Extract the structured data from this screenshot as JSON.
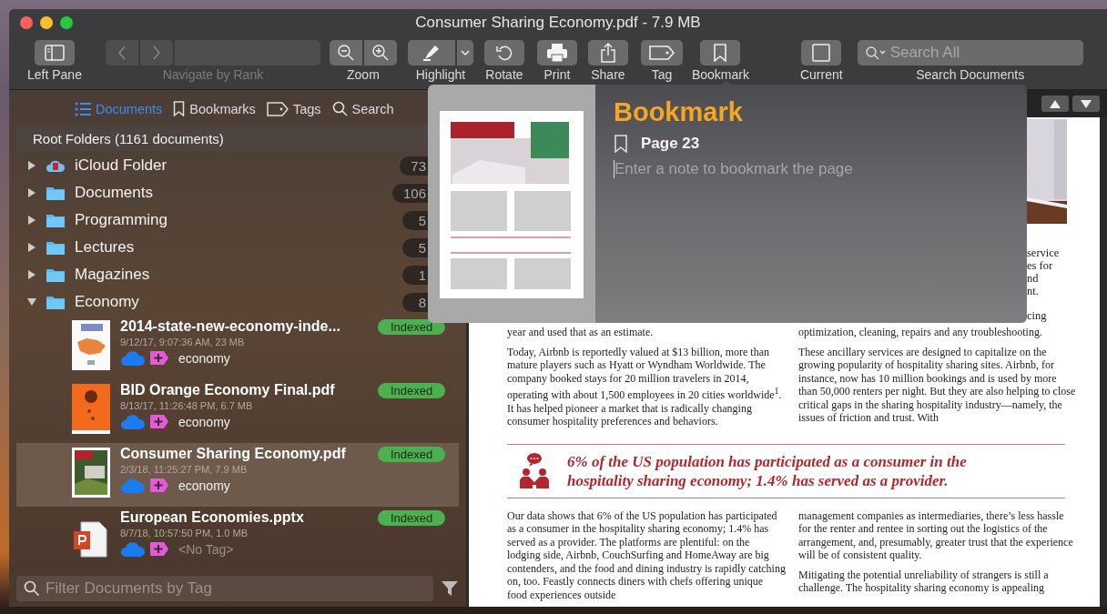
{
  "window": {
    "title": "Consumer Sharing Economy.pdf - 7.9 MB"
  },
  "toolbar": [
    {
      "kind": "pane",
      "label": "Left Pane",
      "disabled": false
    },
    {
      "kind": "nav",
      "label": "Navigate by Rank",
      "disabled": true
    },
    {
      "kind": "zoom",
      "label": "Zoom",
      "disabled": false
    },
    {
      "kind": "highlight",
      "label": "Highlight",
      "disabled": false
    },
    {
      "kind": "rotate",
      "label": "Rotate",
      "disabled": false
    },
    {
      "kind": "print",
      "label": "Print",
      "disabled": false
    },
    {
      "kind": "share",
      "label": "Share",
      "disabled": false
    },
    {
      "kind": "tag",
      "label": "Tag",
      "disabled": false
    },
    {
      "kind": "bookmark",
      "label": "Bookmark",
      "disabled": false
    },
    {
      "kind": "current",
      "label": "Current",
      "disabled": false
    },
    {
      "kind": "search",
      "label": "Search Documents",
      "placeholder": "Search All",
      "disabled": false
    }
  ],
  "sidebar": {
    "tabs": [
      {
        "kind": "list",
        "label": "Documents",
        "selected": true
      },
      {
        "kind": "bookmark",
        "label": "Bookmarks",
        "selected": false
      },
      {
        "kind": "tag",
        "label": "Tags",
        "selected": false
      },
      {
        "kind": "search",
        "label": "Search",
        "selected": false
      }
    ],
    "header": "Root Folders (1161 documents)",
    "folders": [
      {
        "kind": "cloud",
        "name": "iCloud Folder",
        "count": "73",
        "expanded": false
      },
      {
        "kind": "folder",
        "name": "Documents",
        "count": "106",
        "expanded": false
      },
      {
        "kind": "folder",
        "name": "Programming",
        "count": "5",
        "expanded": false
      },
      {
        "kind": "folder",
        "name": "Lectures",
        "count": "5",
        "expanded": false
      },
      {
        "kind": "folder",
        "name": "Magazines",
        "count": "1",
        "expanded": false
      },
      {
        "kind": "folder",
        "name": "Economy",
        "count": "8",
        "expanded": true,
        "children": [
          {
            "kind": "map",
            "name": "2014-state-new-economy-inde...",
            "meta": "9/12/17, 9:07:36 AM, 23 MB",
            "tag": "economy",
            "tagged": true,
            "status": "Indexed",
            "selected": false
          },
          {
            "kind": "orange",
            "name": "BID Orange Economy Final.pdf",
            "meta": "8/13/17, 11:26:48 PM, 6.7 MB",
            "tag": "economy",
            "tagged": true,
            "status": "Indexed",
            "selected": false
          },
          {
            "name": "Consumer Sharing Economy.pdf",
            "meta": "2/3/18, 11:25:27 PM, 7.9 MB",
            "tag": "economy",
            "tagged": true,
            "status": "Indexed",
            "selected": true
          },
          {
            "kind": "presentation",
            "name": "European Economies.pptx",
            "meta": "8/7/18, 10:57:50 PM, 1.0 MB",
            "tag": "<No Tag>",
            "tagged": false,
            "status": "Indexed",
            "selected": false
          }
        ]
      }
    ],
    "filter": {
      "placeholder": "Filter Documents by Tag"
    }
  },
  "popover": {
    "title": "Bookmark",
    "page": "Page 23",
    "note_placeholder": "Enter a note to bookmark the page"
  },
  "document": {
    "fragments": [
      {
        "lines": [
          "service",
          "es for",
          "nd",
          "nt."
        ]
      },
      {
        "lines": [
          "cing"
        ]
      }
    ],
    "columns_top": [
      {
        "paragraphs": [
          "year and used that as an estimate.",
          "Today, Airbnb is reportedly valued at $13 billion, more than mature players such as Hyatt or Wyndham Worldwide. The company booked stays for 20 million travelers in 2014, operating with about 1,500 employees in 20 cities worldwide$^{1}$. It has helped pioneer a market that is radically changing consumer hospitality preferences and behaviors."
        ]
      },
      {
        "paragraphs": [
          "optimization, cleaning, repairs and any troubleshooting.",
          "These ancillary services are designed to capitalize on the growing popularity of hospitality sharing sites. Airbnb, for instance, now has 10 million bookings and is used by more than 50,000 renters per night. But they are also helping to close critical gaps in the sharing hospitality industry—namely, the issues of friction and trust. With"
        ]
      }
    ],
    "callout": "6% of the US population has participated as a consumer in the hospitality sharing economy; 1.4% has served as a provider.",
    "columns_bottom": [
      {
        "paragraphs": [
          "Our data shows that 6% of the US population has participated as a consumer in the hospitality sharing economy; 1.4% has served as a provider. The platforms are plentiful: on the lodging side, Airbnb, CouchSurfing and HomeAway are big contenders, and the food and dining industry is rapidly catching on, too. Feastly connects diners with chefs offering unique food experiences outside"
        ]
      },
      {
        "paragraphs": [
          "management companies as intermediaries, there’s less hassle for the renter and rentee in sorting out the logistics of the arrangement, and, presumably, greater trust that the experience will be of consistent quality.",
          "Mitigating the potential unreliability of strangers is still a challenge. The hospitality sharing economy is appealing"
        ]
      }
    ]
  }
}
